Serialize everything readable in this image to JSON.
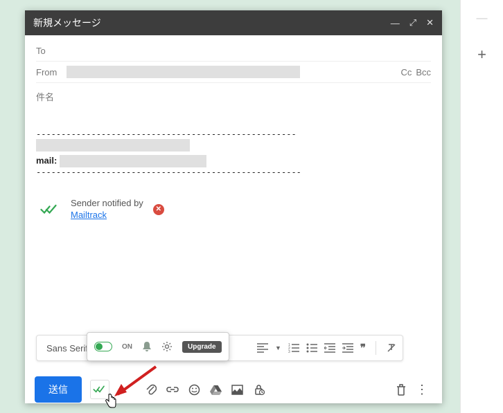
{
  "window": {
    "title": "新規メッセージ"
  },
  "fields": {
    "to_label": "To",
    "from_label": "From",
    "cc_label": "Cc",
    "bcc_label": "Bcc",
    "subject_placeholder": "件名"
  },
  "signature": {
    "dashes_top": "----------------------------------------------------",
    "mail_label": "mail:",
    "dashes_bottom": "-----------------------------------------------------"
  },
  "mailtrack": {
    "notified_text": "Sender notified by",
    "link_text": "Mailtrack",
    "toggle_label": "ON",
    "upgrade_label": "Upgrade"
  },
  "format": {
    "font_name": "Sans Serif"
  },
  "toolbar": {
    "send_label": "送信"
  }
}
